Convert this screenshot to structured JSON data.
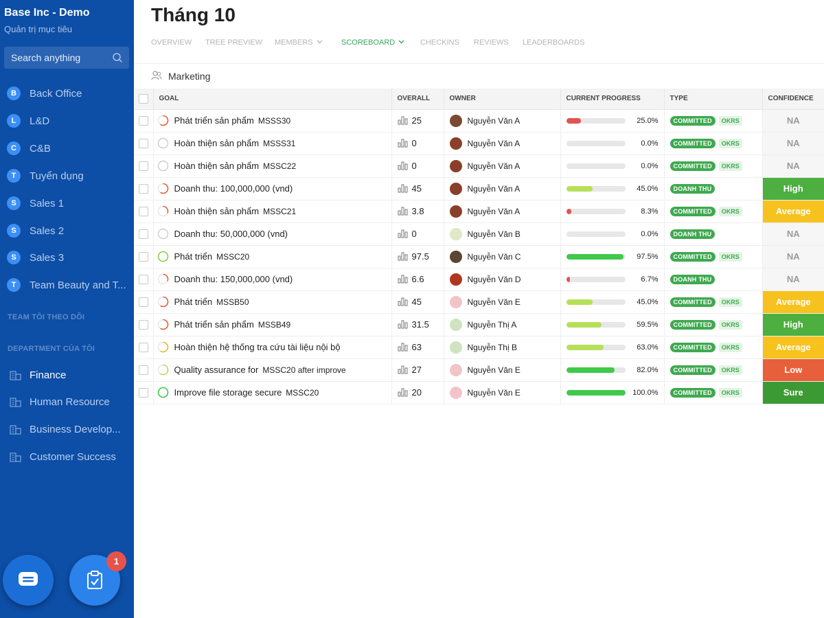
{
  "colors": {
    "sidebar": "#0d4ea6",
    "badge": "#3c8ff5",
    "accent_green": "#3fa950",
    "confidence": {
      "High": "#4caf3f",
      "Average": "#f7c21d",
      "Low": "#e8603b",
      "Sure": "#3c9a35",
      "NA": "#f6f6f6"
    },
    "progress": {
      "red": "#e25353",
      "lime": "#b7e05a",
      "green": "#40c94b"
    }
  },
  "sidebar": {
    "title": "Base Inc - Demo",
    "subtitle": "Quản trị mục tiêu",
    "search_placeholder": "Search anything",
    "search_icon": "search-icon",
    "teams": [
      {
        "initial": "B",
        "label": "Back Office"
      },
      {
        "initial": "L",
        "label": "L&D"
      },
      {
        "initial": "C",
        "label": "C&B"
      },
      {
        "initial": "T",
        "label": "Tuyển dụng"
      },
      {
        "initial": "S",
        "label": "Sales 1"
      },
      {
        "initial": "S",
        "label": "Sales 2"
      },
      {
        "initial": "S",
        "label": "Sales 3"
      },
      {
        "initial": "T",
        "label": "Team Beauty and T..."
      }
    ],
    "section_followed": "TEAM TÔI THEO DÕI",
    "section_department": "DEPARTMENT CỦA TÔI",
    "departments": [
      {
        "label": "Finance",
        "active": true
      },
      {
        "label": "Human Resource",
        "active": false
      },
      {
        "label": "Business Develop...",
        "active": false
      },
      {
        "label": "Customer Success",
        "active": false
      }
    ],
    "task_count": "1"
  },
  "main": {
    "title": "Tháng 10",
    "tabs": [
      {
        "label": "OVERVIEW",
        "active": false
      },
      {
        "label": "TREE PREVIEW",
        "active": false
      },
      {
        "label": "MEMBERS",
        "active": false,
        "dropdown": true
      },
      {
        "label": "SCOREBOARD",
        "active": true,
        "dropdown": true
      },
      {
        "label": "CHECKINS",
        "active": false
      },
      {
        "label": "REVIEWS",
        "active": false
      },
      {
        "label": "LEADERBOARDS",
        "active": false
      }
    ],
    "team_name": "Marketing",
    "columns": {
      "goal": "GOAL",
      "overall": "OVERALL",
      "owner": "OWNER",
      "progress": "CURRENT PROGRESS",
      "type": "TYPE",
      "confidence": "CONFIDENCE"
    },
    "rows": [
      {
        "goal": "Phát triển sản phẩm",
        "code": "MSSS30",
        "overall": "25",
        "owner": "Nguyễn Văn A",
        "avatar": "#7a4a32",
        "progress": 25,
        "progress_text": "25.0%",
        "progress_color": "red",
        "type": "COMMITTED",
        "okrs": "OKRS",
        "confidence": "NA",
        "ring": "#e8603b"
      },
      {
        "goal": "Hoàn thiện sản phẩm",
        "code": "MSSS31",
        "overall": "0",
        "owner": "Nguyễn Văn A",
        "avatar": "#8a3f2a",
        "progress": 0,
        "progress_text": "0.0%",
        "progress_color": "red",
        "type": "COMMITTED",
        "okrs": "OKRS",
        "confidence": "NA",
        "ring": "#cccccc"
      },
      {
        "goal": "Hoàn thiện sản phẩm",
        "code": "MSSC22",
        "overall": "0",
        "owner": "Nguyễn Văn A",
        "avatar": "#8a3f2a",
        "progress": 0,
        "progress_text": "0.0%",
        "progress_color": "red",
        "type": "COMMITTED",
        "okrs": "OKRS",
        "confidence": "NA",
        "ring": "#cccccc"
      },
      {
        "goal": "Doanh thu: 100,000,000 (vnd)",
        "code": "",
        "overall": "45",
        "owner": "Nguyễn Văn A",
        "avatar": "#8a3f2a",
        "progress": 45,
        "progress_text": "45.0%",
        "progress_color": "lime",
        "type": "DOANH THU",
        "okrs": "",
        "confidence": "High",
        "ring": "#e8603b"
      },
      {
        "goal": "Hoàn thiện sản phẩm",
        "code": "MSSC21",
        "overall": "3.8",
        "owner": "Nguyễn Văn A",
        "avatar": "#8a3f2a",
        "progress": 8.3,
        "progress_text": "8.3%",
        "progress_color": "red",
        "type": "COMMITTED",
        "okrs": "OKRS",
        "confidence": "Average",
        "ring": "#e8603b"
      },
      {
        "goal": "Doanh thu: 50,000,000 (vnd)",
        "code": "",
        "overall": "0",
        "owner": "Nguyễn Văn B",
        "avatar": "#dfe8c8",
        "progress": 0,
        "progress_text": "0.0%",
        "progress_color": "red",
        "type": "DOANH THU",
        "okrs": "",
        "confidence": "NA",
        "ring": "#cccccc"
      },
      {
        "goal": "Phát triển",
        "code": "MSSC20",
        "overall": "97.5",
        "owner": "Nguyễn Văn C",
        "avatar": "#5a4632",
        "progress": 97.5,
        "progress_text": "97.5%",
        "progress_color": "green",
        "type": "COMMITTED",
        "okrs": "OKRS",
        "confidence": "NA",
        "ring": "#8ccf4a"
      },
      {
        "goal": "Doanh thu: 150,000,000 (vnd)",
        "code": "",
        "overall": "6.6",
        "owner": "Nguyễn Văn D",
        "avatar": "#b0361e",
        "progress": 6.7,
        "progress_text": "6.7%",
        "progress_color": "red",
        "type": "DOANH THU",
        "okrs": "",
        "confidence": "NA",
        "ring": "#e8603b"
      },
      {
        "goal": "Phát triển",
        "code": "MSSB50",
        "overall": "45",
        "owner": "Nguyễn Văn E",
        "avatar": "#f2c4c8",
        "progress": 45,
        "progress_text": "45.0%",
        "progress_color": "lime",
        "type": "COMMITTED",
        "okrs": "OKRS",
        "confidence": "Average",
        "ring": "#e8603b"
      },
      {
        "goal": "Phát triển sản phẩm",
        "code": "MSSB49",
        "overall": "31.5",
        "owner": "Nguyễn Thị A",
        "avatar": "#cfe3c0",
        "progress": 59.5,
        "progress_text": "59.5%",
        "progress_color": "lime",
        "type": "COMMITTED",
        "okrs": "OKRS",
        "confidence": "High",
        "ring": "#e8603b"
      },
      {
        "goal": "Hoàn thiện hệ thống tra cứu tài liệu nội bộ",
        "code": "",
        "overall": "63",
        "owner": "Nguyễn Thị B",
        "avatar": "#cfe3c0",
        "progress": 63,
        "progress_text": "63.0%",
        "progress_color": "lime",
        "type": "COMMITTED",
        "okrs": "OKRS",
        "confidence": "Average",
        "ring": "#f0b429"
      },
      {
        "goal": "Quality assurance for",
        "code": "MSSC20   after improve",
        "overall": "27",
        "owner": "Nguyễn Văn E",
        "avatar": "#f2c4c8",
        "progress": 82,
        "progress_text": "82.0%",
        "progress_color": "green",
        "type": "COMMITTED",
        "okrs": "OKRS",
        "confidence": "Low",
        "ring": "#b7d95a"
      },
      {
        "goal": "Improve file storage secure",
        "code": "MSSC20",
        "overall": "20",
        "owner": "Nguyễn Văn E",
        "avatar": "#f2c4c8",
        "progress": 100,
        "progress_text": "100.0%",
        "progress_color": "green",
        "type": "COMMITTED",
        "okrs": "OKRS",
        "confidence": "Sure",
        "ring": "#40c94b"
      }
    ]
  }
}
